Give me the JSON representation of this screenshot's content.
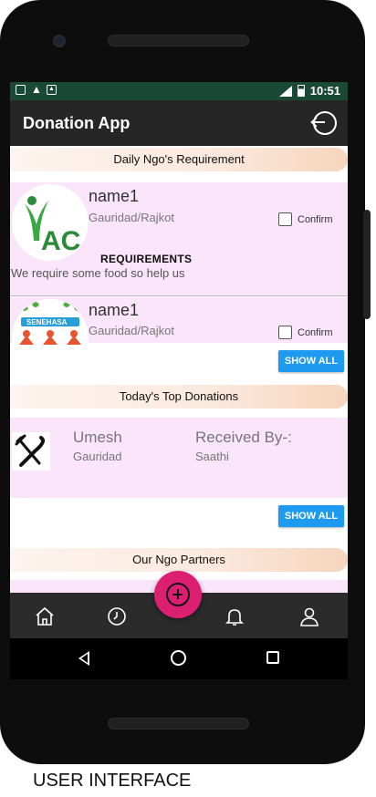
{
  "status_bar": {
    "time": "10:51"
  },
  "app_bar": {
    "title": "Donation App"
  },
  "sections": {
    "daily": "Daily Ngo's Requirement",
    "top_donations": "Today's Top Donations",
    "partners": "Our Ngo Partners"
  },
  "requirements": [
    {
      "logo_text": "AC",
      "name": "name1",
      "location": "Gauridad/Rajkot",
      "confirm_label": "Confirm",
      "req_title": "REQUIREMENTS",
      "req_text": "We require some food so help us"
    },
    {
      "logo_text": "SENEHASA",
      "name": "name1",
      "location": "Gauridad/Rajkot",
      "confirm_label": "Confirm"
    }
  ],
  "show_all_label": "SHOW ALL",
  "donation": {
    "donor": "Umesh",
    "location": "Gauridad",
    "received_by_label": "Received By-:",
    "receiver": "Saathi"
  },
  "bottom_nav": [
    "home-icon",
    "history-icon",
    "add-icon",
    "bell-icon",
    "profile-icon"
  ],
  "colors": {
    "accent": "#dd1f72",
    "button": "#1e9af0",
    "status_bar": "#1a4a37",
    "card": "#fae5fa"
  },
  "caption": "USER INTERFACE"
}
